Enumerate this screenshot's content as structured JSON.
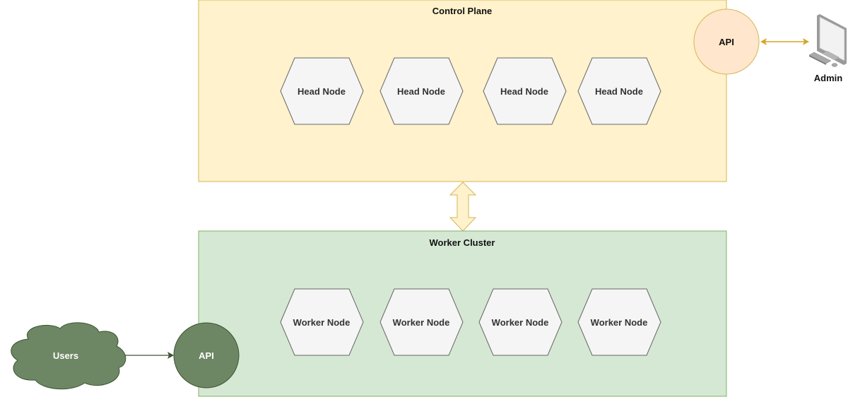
{
  "colors": {
    "control_fill": "#fff2cc",
    "control_stroke": "#d6b656",
    "worker_fill": "#d5e8d4",
    "worker_stroke": "#82b366",
    "node_fill": "#f5f5f5",
    "node_stroke": "#666666",
    "api_admin_fill": "#ffe6cc",
    "api_admin_stroke": "#d79b00",
    "user_green": "#6d8764",
    "user_green_stroke": "#3a5431",
    "arrow_gold": "#d6a52a"
  },
  "control_plane": {
    "title": "Control Plane",
    "nodes": [
      "Head Node",
      "Head Node",
      "Head Node",
      "Head Node"
    ],
    "api_label": "API"
  },
  "admin": {
    "label": "Admin",
    "icon": "desktop-computer-icon"
  },
  "worker_cluster": {
    "title": "Worker Cluster",
    "nodes": [
      "Worker Node",
      "Worker Node",
      "Worker Node",
      "Worker Node"
    ],
    "api_label": "API"
  },
  "users": {
    "label": "Users",
    "icon": "cloud-icon"
  }
}
